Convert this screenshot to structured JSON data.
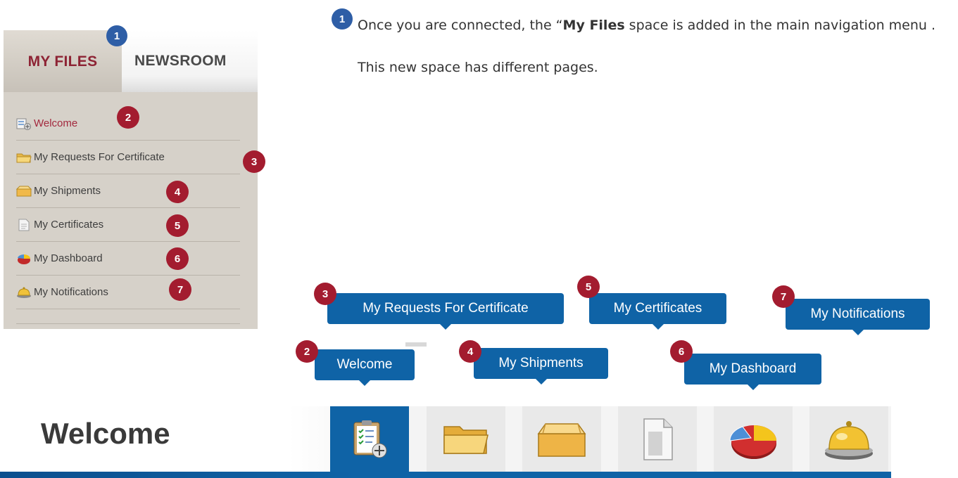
{
  "menu": {
    "tabs": [
      {
        "label": "MY FILES",
        "active": true
      },
      {
        "label": "NEWSROOM",
        "active": false
      }
    ],
    "items": [
      {
        "label": "Welcome",
        "icon": "welcome-icon",
        "badge": "2"
      },
      {
        "label": "My Requests For Certificate",
        "icon": "folder-icon",
        "badge": "3"
      },
      {
        "label": "My Shipments",
        "icon": "shipment-box-icon",
        "badge": "4"
      },
      {
        "label": "My Certificates",
        "icon": "document-icon",
        "badge": "5"
      },
      {
        "label": "My Dashboard",
        "icon": "pie-chart-icon",
        "badge": "6"
      },
      {
        "label": "My Notifications",
        "icon": "bell-icon",
        "badge": "7"
      }
    ],
    "tab_badge": "1"
  },
  "instruction": {
    "badge": "1",
    "line1_before": "Once you are connected, the “",
    "line1_bold": "My Files",
    "line1_after": " space  is added in the main navigation menu .",
    "line2": "This new space has different pages."
  },
  "callouts": [
    {
      "label": "My Requests For Certificate",
      "badge": "3"
    },
    {
      "label": "My Certificates",
      "badge": "5"
    },
    {
      "label": "My Notifications",
      "badge": "7"
    },
    {
      "label": "Welcome",
      "badge": "2"
    },
    {
      "label": "My Shipments",
      "badge": "4"
    },
    {
      "label": "My Dashboard",
      "badge": "6"
    }
  ],
  "page": {
    "title": "Welcome"
  },
  "icon_bar": [
    {
      "icon": "clipboard-checklist-icon",
      "active": true
    },
    {
      "icon": "open-folder-icon",
      "active": false
    },
    {
      "icon": "shipment-box-icon",
      "active": false
    },
    {
      "icon": "certificate-document-icon",
      "active": false
    },
    {
      "icon": "pie-chart-icon",
      "active": false
    },
    {
      "icon": "service-bell-icon",
      "active": false
    }
  ],
  "colors": {
    "brand_blue": "#0f63a6",
    "badge_red": "#a31c2f",
    "badge_blue": "#2e5ea6",
    "active_tab_text": "#8d2334"
  }
}
